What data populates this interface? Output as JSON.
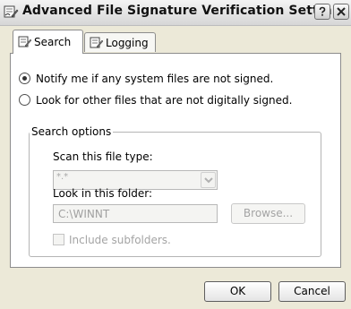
{
  "window": {
    "title": "Advanced File Signature Verification Settin..."
  },
  "tabs": [
    {
      "label": "Search",
      "active": true
    },
    {
      "label": "Logging",
      "active": false
    }
  ],
  "search": {
    "radio_notify": {
      "label": "Notify me if any system files are not signed.",
      "selected": true
    },
    "radio_look": {
      "label": "Look for other files that are not digitally signed.",
      "selected": false
    },
    "options": {
      "legend": "Search options",
      "file_type_label": "Scan this file type:",
      "file_type_value": "*.*",
      "folder_label": "Look in this folder:",
      "folder_value": "C:\\WINNT",
      "browse_label": "Browse...",
      "subfolders_label": "Include subfolders."
    }
  },
  "buttons": {
    "ok": "OK",
    "cancel": "Cancel"
  },
  "icons": {
    "title": "signature-verification-icon",
    "tab_search": "search-tab-icon",
    "tab_logging": "logging-tab-icon",
    "help": "help-icon",
    "close": "close-icon",
    "dropdown": "chevron-down-icon"
  }
}
